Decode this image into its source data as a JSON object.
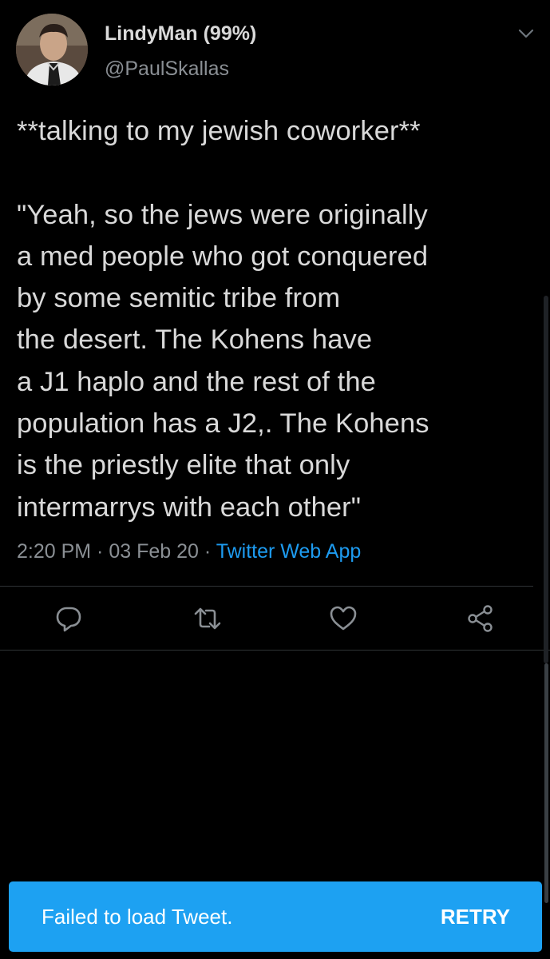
{
  "tweet": {
    "author": {
      "display_name": "LindyMan (99%)",
      "handle": "@PaulSkallas"
    },
    "text": "**talking to my jewish coworker**\n\n\"Yeah, so the jews were originally\na med people who got conquered\nby some semitic tribe from\nthe desert. The Kohens have\na J1 haplo and the rest of the\npopulation has a J2,. The Kohens\nis the priestly elite that only\nintermarrys with each other\"",
    "time": "2:20 PM",
    "separator_1": " · ",
    "date": "03 Feb 20",
    "separator_2": " · ",
    "source": "Twitter Web App",
    "actions": {
      "reply_icon": "reply-icon",
      "retweet_icon": "retweet-icon",
      "like_icon": "like-icon",
      "share_icon": "share-icon"
    }
  },
  "snackbar": {
    "message": "Failed to load Tweet.",
    "action_label": "RETRY",
    "background": "#1da1f2"
  },
  "colors": {
    "background": "#000000",
    "primary_text": "#d9d9d9",
    "secondary_text": "#8a8f94",
    "link": "#1d9bf0"
  }
}
